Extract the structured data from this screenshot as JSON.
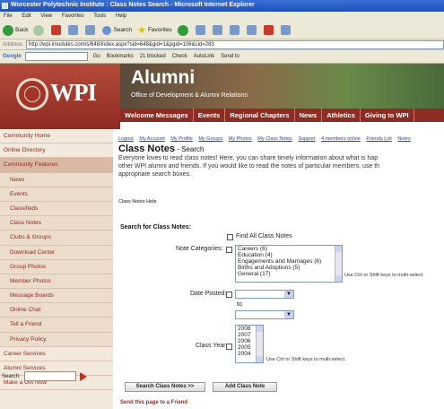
{
  "window": {
    "title": "Worcester Polytechnic Institute : Class Notes Search - Microsoft Internet Explorer"
  },
  "menubar": {
    "items": [
      "File",
      "Edit",
      "View",
      "Favorites",
      "Tools",
      "Help"
    ]
  },
  "toolbar": {
    "back_label": "Back",
    "search_label": "Search",
    "favorites_label": "Favorites"
  },
  "address": {
    "label": "Address",
    "url": "http://wpi.imodules.com/s/648/index.aspx?sid=648&gid=1&pgid=106&cid=283"
  },
  "googlebar": {
    "logo": "Google",
    "items": [
      "Go",
      "Bookmarks",
      "21 blocked",
      "Check",
      "AutoLink",
      "Send to"
    ]
  },
  "site": {
    "logo_text": "WPI",
    "banner_title": "Alumni",
    "banner_subtitle": "Office of Development & Alumni Relations",
    "nav": [
      "Welcome Messages",
      "Events",
      "Regional Chapters",
      "News",
      "Athletics",
      "Giving to WPI"
    ]
  },
  "sidebar": {
    "items": [
      {
        "label": "Community Home"
      },
      {
        "label": "Online Directory"
      },
      {
        "label": "Community Features"
      },
      {
        "label": "News"
      },
      {
        "label": "Events"
      },
      {
        "label": "Classifieds"
      },
      {
        "label": "Class Notes"
      },
      {
        "label": "Clubs & Groups"
      },
      {
        "label": "Download Center"
      },
      {
        "label": "Group Photos"
      },
      {
        "label": "Member Photos"
      },
      {
        "label": "Message Boards"
      },
      {
        "label": "Online Chat"
      },
      {
        "label": "Tell a Friend"
      },
      {
        "label": "Privacy Policy"
      },
      {
        "label": "Career Services"
      },
      {
        "label": "Alumni Services"
      },
      {
        "label": "Make a Gift Now"
      }
    ],
    "search_label": "Search:"
  },
  "main": {
    "top_links": [
      "Logout",
      "My Account",
      "My Profile",
      "My Groups",
      "My Photos",
      "My Class Notes",
      "Support",
      "4 members online",
      "Friends List",
      "Notes"
    ],
    "title": "Class Notes",
    "title_sub": " - Search",
    "intro_line1": "Everyone loves to read class notes! Here, you can share timely information about what is hap",
    "intro_line2": "other WPI alumni and friends.  If you would like to read the notes of particular members, use th",
    "intro_line3": "appropriate search boxes.",
    "help_link": "Class Notes Help",
    "search_section": "Search for Class Notes:",
    "find_all_label": "Find All Class Notes",
    "note_categories_label": "Note Categories:",
    "categories": [
      "Careers (6)",
      "Education (4)",
      "Engagements and Marriages (6)",
      "Births and Adoptions (5)",
      "General (17)"
    ],
    "multi_select_hint": "Use Ctrl or Shift keys to multi-select.",
    "date_posted_label": "Date Posted:",
    "to_label": "to",
    "class_year_label": "Class Year:",
    "years": [
      "2008",
      "2007",
      "2006",
      "2005",
      "2004"
    ],
    "search_button": "Search Class Notes >>",
    "add_button": "Add Class Note",
    "send_link": "Send this page to a Friend"
  }
}
